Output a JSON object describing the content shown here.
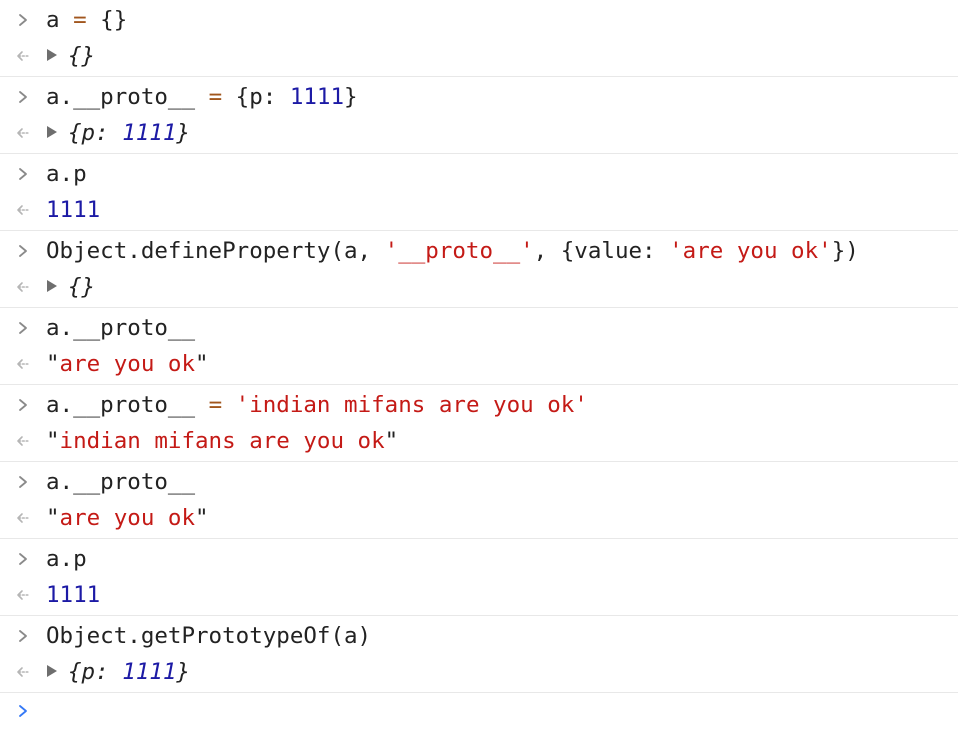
{
  "console": {
    "entries": [
      {
        "input": [
          {
            "t": "a ",
            "c": "plain"
          },
          {
            "t": "=",
            "c": "op"
          },
          {
            "t": " {}",
            "c": "plain"
          }
        ],
        "output": {
          "expandable": true,
          "italic": true,
          "tokens": [
            {
              "t": "{}",
              "c": "plain"
            }
          ]
        }
      },
      {
        "input": [
          {
            "t": "a.__proto__ ",
            "c": "plain"
          },
          {
            "t": "=",
            "c": "op"
          },
          {
            "t": " {p: ",
            "c": "plain"
          },
          {
            "t": "1111",
            "c": "num"
          },
          {
            "t": "}",
            "c": "plain"
          }
        ],
        "output": {
          "expandable": true,
          "italic": true,
          "tokens": [
            {
              "t": "{p: ",
              "c": "plain"
            },
            {
              "t": "1111",
              "c": "num"
            },
            {
              "t": "}",
              "c": "plain"
            }
          ]
        }
      },
      {
        "input": [
          {
            "t": "a.p",
            "c": "plain"
          }
        ],
        "output": {
          "expandable": false,
          "italic": false,
          "tokens": [
            {
              "t": "1111",
              "c": "num"
            }
          ]
        }
      },
      {
        "input": [
          {
            "t": "Object.defineProperty(a, ",
            "c": "plain"
          },
          {
            "t": "'__proto__'",
            "c": "str"
          },
          {
            "t": ", {value: ",
            "c": "plain"
          },
          {
            "t": "'are you ok'",
            "c": "str"
          },
          {
            "t": "})",
            "c": "plain"
          }
        ],
        "output": {
          "expandable": true,
          "italic": true,
          "tokens": [
            {
              "t": "{}",
              "c": "plain"
            }
          ]
        }
      },
      {
        "input": [
          {
            "t": "a.__proto__",
            "c": "plain"
          }
        ],
        "output": {
          "expandable": false,
          "italic": false,
          "tokens": [
            {
              "t": "\"",
              "c": "plain"
            },
            {
              "t": "are you ok",
              "c": "str"
            },
            {
              "t": "\"",
              "c": "plain"
            }
          ]
        }
      },
      {
        "input": [
          {
            "t": "a.__proto__ ",
            "c": "plain"
          },
          {
            "t": "=",
            "c": "op"
          },
          {
            "t": " ",
            "c": "plain"
          },
          {
            "t": "'indian mifans are you ok'",
            "c": "str"
          }
        ],
        "output": {
          "expandable": false,
          "italic": false,
          "tokens": [
            {
              "t": "\"",
              "c": "plain"
            },
            {
              "t": "indian mifans are you ok",
              "c": "str"
            },
            {
              "t": "\"",
              "c": "plain"
            }
          ]
        }
      },
      {
        "input": [
          {
            "t": "a.__proto__",
            "c": "plain"
          }
        ],
        "output": {
          "expandable": false,
          "italic": false,
          "tokens": [
            {
              "t": "\"",
              "c": "plain"
            },
            {
              "t": "are you ok",
              "c": "str"
            },
            {
              "t": "\"",
              "c": "plain"
            }
          ]
        }
      },
      {
        "input": [
          {
            "t": "a.p",
            "c": "plain"
          }
        ],
        "output": {
          "expandable": false,
          "italic": false,
          "tokens": [
            {
              "t": "1111",
              "c": "num"
            }
          ]
        }
      },
      {
        "input": [
          {
            "t": "Object.getPrototypeOf(a)",
            "c": "plain"
          }
        ],
        "output": {
          "expandable": true,
          "italic": true,
          "tokens": [
            {
              "t": "{p: ",
              "c": "plain"
            },
            {
              "t": "1111",
              "c": "num"
            },
            {
              "t": "}",
              "c": "plain"
            }
          ]
        }
      }
    ]
  },
  "icons": {
    "input_prompt": "chevron-right-icon",
    "output_prompt": "result-arrow-icon",
    "expand": "disclosure-triangle-icon",
    "active_prompt": "active-prompt-chevron-icon"
  },
  "colors": {
    "text": "#222222",
    "operator": "#a1561d",
    "number": "#1c1aa5",
    "string": "#c41a16",
    "input_chevron": "#8a8a8a",
    "output_arrow": "#b5b5b5",
    "active_chevron": "#3478f6",
    "divider": "#e8e8e8"
  }
}
